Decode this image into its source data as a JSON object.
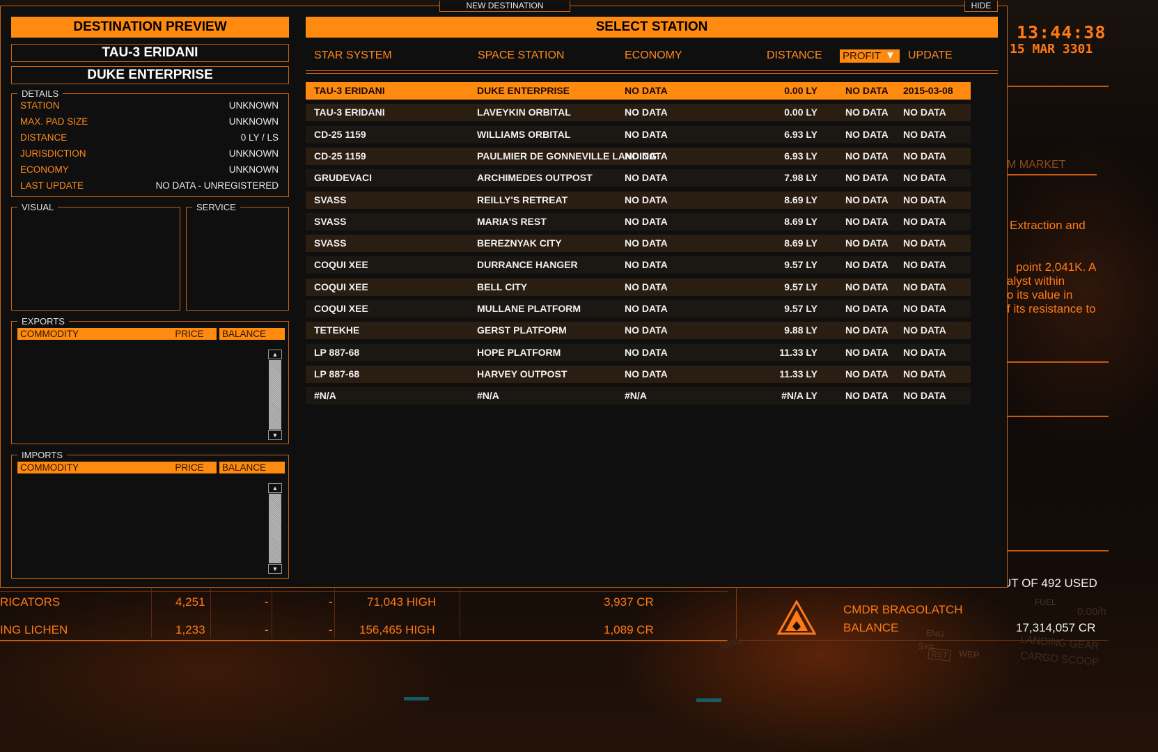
{
  "overlay": {
    "tab_new_destination": "NEW DESTINATION",
    "tab_hide": "HIDE"
  },
  "preview": {
    "title": "DESTINATION PREVIEW",
    "system": "TAU-3 ERIDANI",
    "station": "DUKE ENTERPRISE",
    "details_legend": "DETAILS",
    "details": [
      {
        "label": "STATION",
        "value": "UNKNOWN"
      },
      {
        "label": "MAX. PAD SIZE",
        "value": "UNKNOWN"
      },
      {
        "label": "DISTANCE",
        "value": "0 LY /  LS"
      },
      {
        "label": "JURISDICTION",
        "value": "UNKNOWN"
      },
      {
        "label": "ECONOMY",
        "value": "UNKNOWN"
      },
      {
        "label": "LAST UPDATE",
        "value": "NO DATA - UNREGISTERED"
      }
    ],
    "visual_legend": "VISUAL",
    "service_legend": "SERVICE",
    "exports_legend": "EXPORTS",
    "imports_legend": "IMPORTS",
    "market_columns": [
      "COMMODITY",
      "PRICE",
      "BALANCE"
    ]
  },
  "select": {
    "title": "SELECT STATION",
    "columns": {
      "star_system": "STAR SYSTEM",
      "space_station": "SPACE STATION",
      "economy": "ECONOMY",
      "distance": "DISTANCE",
      "profit": "PROFIT",
      "update": "UPDATE"
    },
    "sort_column": "PROFIT",
    "rows": [
      {
        "system": "TAU-3 ERIDANI",
        "station": "DUKE ENTERPRISE",
        "economy": "NO DATA",
        "distance": "0.00 LY",
        "profit": "NO DATA",
        "update": "2015-03-08",
        "selected": true
      },
      {
        "system": "TAU-3 ERIDANI",
        "station": "LAVEYKIN ORBITAL",
        "economy": "NO DATA",
        "distance": "0.00 LY",
        "profit": "NO DATA",
        "update": "NO DATA"
      },
      {
        "system": "CD-25 1159",
        "station": "WILLIAMS ORBITAL",
        "economy": "NO DATA",
        "distance": "6.93 LY",
        "profit": "NO DATA",
        "update": "NO DATA"
      },
      {
        "system": "CD-25 1159",
        "station": "PAULMIER DE GONNEVILLE LANDING",
        "economy": "NO DATA",
        "distance": "6.93 LY",
        "profit": "NO DATA",
        "update": "NO DATA"
      },
      {
        "system": "GRUDEVACI",
        "station": "ARCHIMEDES OUTPOST",
        "economy": "NO DATA",
        "distance": "7.98 LY",
        "profit": "NO DATA",
        "update": "NO DATA"
      },
      {
        "system": "SVASS",
        "station": "REILLY'S RETREAT",
        "economy": "NO DATA",
        "distance": "8.69 LY",
        "profit": "NO DATA",
        "update": "NO DATA"
      },
      {
        "system": "SVASS",
        "station": "MARIA'S REST",
        "economy": "NO DATA",
        "distance": "8.69 LY",
        "profit": "NO DATA",
        "update": "NO DATA"
      },
      {
        "system": "SVASS",
        "station": "BEREZNYAK CITY",
        "economy": "NO DATA",
        "distance": "8.69 LY",
        "profit": "NO DATA",
        "update": "NO DATA"
      },
      {
        "system": "COQUI XEE",
        "station": "DURRANCE HANGER",
        "economy": "NO DATA",
        "distance": "9.57 LY",
        "profit": "NO DATA",
        "update": "NO DATA"
      },
      {
        "system": "COQUI XEE",
        "station": "BELL CITY",
        "economy": "NO DATA",
        "distance": "9.57 LY",
        "profit": "NO DATA",
        "update": "NO DATA"
      },
      {
        "system": "COQUI XEE",
        "station": "MULLANE PLATFORM",
        "economy": "NO DATA",
        "distance": "9.57 LY",
        "profit": "NO DATA",
        "update": "NO DATA"
      },
      {
        "system": "TETEKHE",
        "station": "GERST PLATFORM",
        "economy": "NO DATA",
        "distance": "9.88 LY",
        "profit": "NO DATA",
        "update": "NO DATA"
      },
      {
        "system": "LP 887-68",
        "station": "HOPE PLATFORM",
        "economy": "NO DATA",
        "distance": "11.33 LY",
        "profit": "NO DATA",
        "update": "NO DATA"
      },
      {
        "system": "LP 887-68",
        "station": "HARVEY OUTPOST",
        "economy": "NO DATA",
        "distance": "11.33 LY",
        "profit": "NO DATA",
        "update": "NO DATA"
      },
      {
        "system": "#N/A",
        "station": "#N/A",
        "economy": "#N/A",
        "distance": "#N/A LY",
        "profit": "NO DATA",
        "update": "NO DATA"
      }
    ]
  },
  "game": {
    "time": "13:44:38",
    "date": "15 MAR 3301",
    "right_fragments": [
      "M MARKET",
      "Extraction and",
      "point 2,041K. A",
      "alyst within",
      "o its value in",
      "f its resistance to"
    ],
    "cargo_used": "UT OF 492 USED",
    "commander": "CMDR BRAGOLATCH",
    "balance_label": "BALANCE",
    "balance_value": "17,314,057 CR",
    "market_rows": [
      {
        "name": "RICATORS",
        "sell": "4,251",
        "buy": "-",
        "cargo": "-",
        "demand": "71,043 HIGH",
        "avg": "3,937 CR"
      },
      {
        "name": "ING LICHEN",
        "sell": "1,233",
        "buy": "-",
        "cargo": "-",
        "demand": "156,465 HIGH",
        "avg": "1,089 CR"
      }
    ],
    "status_labels": [
      "SYS",
      "ENG",
      "RST",
      "WEP",
      "FUEL",
      "LANDING GEAR",
      "CARGO SCOOP",
      "0.00/h",
      "100%"
    ]
  },
  "colors": {
    "accent": "#ff8a10",
    "border": "#c8620f",
    "panel": "#0f0f0f"
  }
}
